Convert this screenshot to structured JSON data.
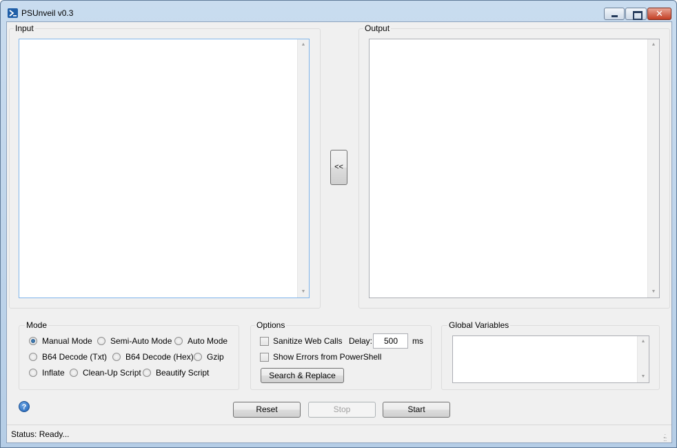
{
  "window": {
    "title": "PSUnveil v0.3",
    "icon": "powershell-icon",
    "controls": {
      "minimize": "minimize-icon",
      "maximize": "maximize-icon",
      "close": "✕"
    }
  },
  "input_panel": {
    "label": "Input",
    "value": ""
  },
  "output_panel": {
    "label": "Output",
    "value": ""
  },
  "transfer_button": {
    "label": "<<"
  },
  "mode": {
    "label": "Mode",
    "options": [
      {
        "label": "Manual Mode",
        "selected": true
      },
      {
        "label": "Semi-Auto Mode",
        "selected": false
      },
      {
        "label": "Auto Mode",
        "selected": false
      },
      {
        "label": "B64 Decode (Txt)",
        "selected": false
      },
      {
        "label": "B64 Decode (Hex)",
        "selected": false
      },
      {
        "label": "Gzip",
        "selected": false
      },
      {
        "label": "Inflate",
        "selected": false
      },
      {
        "label": "Clean-Up Script",
        "selected": false
      },
      {
        "label": "Beautify Script",
        "selected": false
      }
    ]
  },
  "options": {
    "label": "Options",
    "sanitize_label": "Sanitize Web Calls",
    "sanitize_checked": false,
    "show_errors_label": "Show Errors from PowerShell",
    "show_errors_checked": false,
    "delay_label": "Delay:",
    "delay_value": "500",
    "delay_unit": "ms",
    "search_replace_label": "Search & Replace"
  },
  "global_variables": {
    "label": "Global Variables",
    "value": ""
  },
  "actions": {
    "reset": "Reset",
    "stop": "Stop",
    "start": "Start"
  },
  "help_icon": "help-icon",
  "help_glyph": "?",
  "status": {
    "text": "Status: Ready..."
  }
}
